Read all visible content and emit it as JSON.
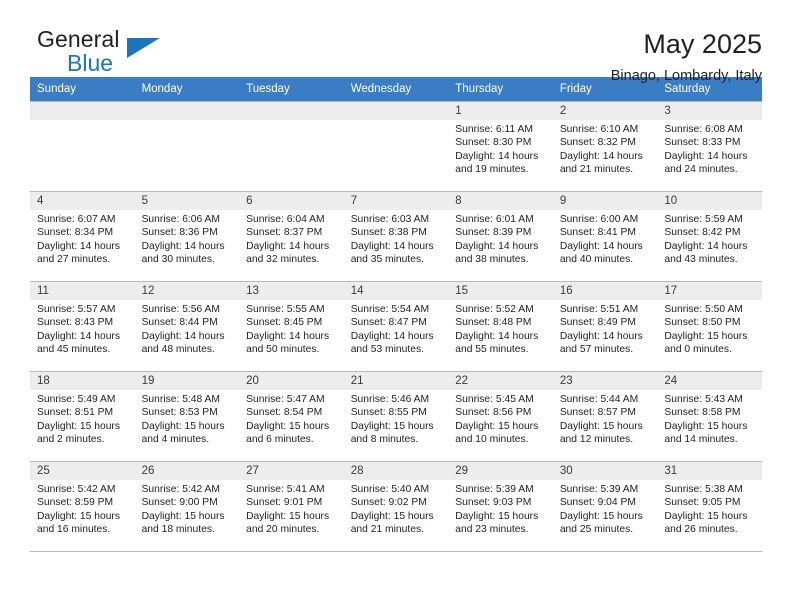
{
  "brand": {
    "name_top": "General",
    "name_bottom": "Blue",
    "accent_color": "#1b75bb"
  },
  "header": {
    "title": "May 2025",
    "subtitle": "Binago, Lombardy, Italy"
  },
  "calendar": {
    "header_bg": "#3b7dc4",
    "weekday_headers": [
      "Sunday",
      "Monday",
      "Tuesday",
      "Wednesday",
      "Thursday",
      "Friday",
      "Saturday"
    ],
    "weeks": [
      [
        {
          "blank": true,
          "day": ""
        },
        {
          "blank": true,
          "day": ""
        },
        {
          "blank": true,
          "day": ""
        },
        {
          "blank": true,
          "day": ""
        },
        {
          "day": "1",
          "sunrise": "Sunrise: 6:11 AM",
          "sunset": "Sunset: 8:30 PM",
          "daylight1": "Daylight: 14 hours",
          "daylight2": "and 19 minutes."
        },
        {
          "day": "2",
          "sunrise": "Sunrise: 6:10 AM",
          "sunset": "Sunset: 8:32 PM",
          "daylight1": "Daylight: 14 hours",
          "daylight2": "and 21 minutes."
        },
        {
          "day": "3",
          "sunrise": "Sunrise: 6:08 AM",
          "sunset": "Sunset: 8:33 PM",
          "daylight1": "Daylight: 14 hours",
          "daylight2": "and 24 minutes."
        }
      ],
      [
        {
          "day": "4",
          "sunrise": "Sunrise: 6:07 AM",
          "sunset": "Sunset: 8:34 PM",
          "daylight1": "Daylight: 14 hours",
          "daylight2": "and 27 minutes."
        },
        {
          "day": "5",
          "sunrise": "Sunrise: 6:06 AM",
          "sunset": "Sunset: 8:36 PM",
          "daylight1": "Daylight: 14 hours",
          "daylight2": "and 30 minutes."
        },
        {
          "day": "6",
          "sunrise": "Sunrise: 6:04 AM",
          "sunset": "Sunset: 8:37 PM",
          "daylight1": "Daylight: 14 hours",
          "daylight2": "and 32 minutes."
        },
        {
          "day": "7",
          "sunrise": "Sunrise: 6:03 AM",
          "sunset": "Sunset: 8:38 PM",
          "daylight1": "Daylight: 14 hours",
          "daylight2": "and 35 minutes."
        },
        {
          "day": "8",
          "sunrise": "Sunrise: 6:01 AM",
          "sunset": "Sunset: 8:39 PM",
          "daylight1": "Daylight: 14 hours",
          "daylight2": "and 38 minutes."
        },
        {
          "day": "9",
          "sunrise": "Sunrise: 6:00 AM",
          "sunset": "Sunset: 8:41 PM",
          "daylight1": "Daylight: 14 hours",
          "daylight2": "and 40 minutes."
        },
        {
          "day": "10",
          "sunrise": "Sunrise: 5:59 AM",
          "sunset": "Sunset: 8:42 PM",
          "daylight1": "Daylight: 14 hours",
          "daylight2": "and 43 minutes."
        }
      ],
      [
        {
          "day": "11",
          "sunrise": "Sunrise: 5:57 AM",
          "sunset": "Sunset: 8:43 PM",
          "daylight1": "Daylight: 14 hours",
          "daylight2": "and 45 minutes."
        },
        {
          "day": "12",
          "sunrise": "Sunrise: 5:56 AM",
          "sunset": "Sunset: 8:44 PM",
          "daylight1": "Daylight: 14 hours",
          "daylight2": "and 48 minutes."
        },
        {
          "day": "13",
          "sunrise": "Sunrise: 5:55 AM",
          "sunset": "Sunset: 8:45 PM",
          "daylight1": "Daylight: 14 hours",
          "daylight2": "and 50 minutes."
        },
        {
          "day": "14",
          "sunrise": "Sunrise: 5:54 AM",
          "sunset": "Sunset: 8:47 PM",
          "daylight1": "Daylight: 14 hours",
          "daylight2": "and 53 minutes."
        },
        {
          "day": "15",
          "sunrise": "Sunrise: 5:52 AM",
          "sunset": "Sunset: 8:48 PM",
          "daylight1": "Daylight: 14 hours",
          "daylight2": "and 55 minutes."
        },
        {
          "day": "16",
          "sunrise": "Sunrise: 5:51 AM",
          "sunset": "Sunset: 8:49 PM",
          "daylight1": "Daylight: 14 hours",
          "daylight2": "and 57 minutes."
        },
        {
          "day": "17",
          "sunrise": "Sunrise: 5:50 AM",
          "sunset": "Sunset: 8:50 PM",
          "daylight1": "Daylight: 15 hours",
          "daylight2": "and 0 minutes."
        }
      ],
      [
        {
          "day": "18",
          "sunrise": "Sunrise: 5:49 AM",
          "sunset": "Sunset: 8:51 PM",
          "daylight1": "Daylight: 15 hours",
          "daylight2": "and 2 minutes."
        },
        {
          "day": "19",
          "sunrise": "Sunrise: 5:48 AM",
          "sunset": "Sunset: 8:53 PM",
          "daylight1": "Daylight: 15 hours",
          "daylight2": "and 4 minutes."
        },
        {
          "day": "20",
          "sunrise": "Sunrise: 5:47 AM",
          "sunset": "Sunset: 8:54 PM",
          "daylight1": "Daylight: 15 hours",
          "daylight2": "and 6 minutes."
        },
        {
          "day": "21",
          "sunrise": "Sunrise: 5:46 AM",
          "sunset": "Sunset: 8:55 PM",
          "daylight1": "Daylight: 15 hours",
          "daylight2": "and 8 minutes."
        },
        {
          "day": "22",
          "sunrise": "Sunrise: 5:45 AM",
          "sunset": "Sunset: 8:56 PM",
          "daylight1": "Daylight: 15 hours",
          "daylight2": "and 10 minutes."
        },
        {
          "day": "23",
          "sunrise": "Sunrise: 5:44 AM",
          "sunset": "Sunset: 8:57 PM",
          "daylight1": "Daylight: 15 hours",
          "daylight2": "and 12 minutes."
        },
        {
          "day": "24",
          "sunrise": "Sunrise: 5:43 AM",
          "sunset": "Sunset: 8:58 PM",
          "daylight1": "Daylight: 15 hours",
          "daylight2": "and 14 minutes."
        }
      ],
      [
        {
          "day": "25",
          "sunrise": "Sunrise: 5:42 AM",
          "sunset": "Sunset: 8:59 PM",
          "daylight1": "Daylight: 15 hours",
          "daylight2": "and 16 minutes."
        },
        {
          "day": "26",
          "sunrise": "Sunrise: 5:42 AM",
          "sunset": "Sunset: 9:00 PM",
          "daylight1": "Daylight: 15 hours",
          "daylight2": "and 18 minutes."
        },
        {
          "day": "27",
          "sunrise": "Sunrise: 5:41 AM",
          "sunset": "Sunset: 9:01 PM",
          "daylight1": "Daylight: 15 hours",
          "daylight2": "and 20 minutes."
        },
        {
          "day": "28",
          "sunrise": "Sunrise: 5:40 AM",
          "sunset": "Sunset: 9:02 PM",
          "daylight1": "Daylight: 15 hours",
          "daylight2": "and 21 minutes."
        },
        {
          "day": "29",
          "sunrise": "Sunrise: 5:39 AM",
          "sunset": "Sunset: 9:03 PM",
          "daylight1": "Daylight: 15 hours",
          "daylight2": "and 23 minutes."
        },
        {
          "day": "30",
          "sunrise": "Sunrise: 5:39 AM",
          "sunset": "Sunset: 9:04 PM",
          "daylight1": "Daylight: 15 hours",
          "daylight2": "and 25 minutes."
        },
        {
          "day": "31",
          "sunrise": "Sunrise: 5:38 AM",
          "sunset": "Sunset: 9:05 PM",
          "daylight1": "Daylight: 15 hours",
          "daylight2": "and 26 minutes."
        }
      ]
    ]
  }
}
